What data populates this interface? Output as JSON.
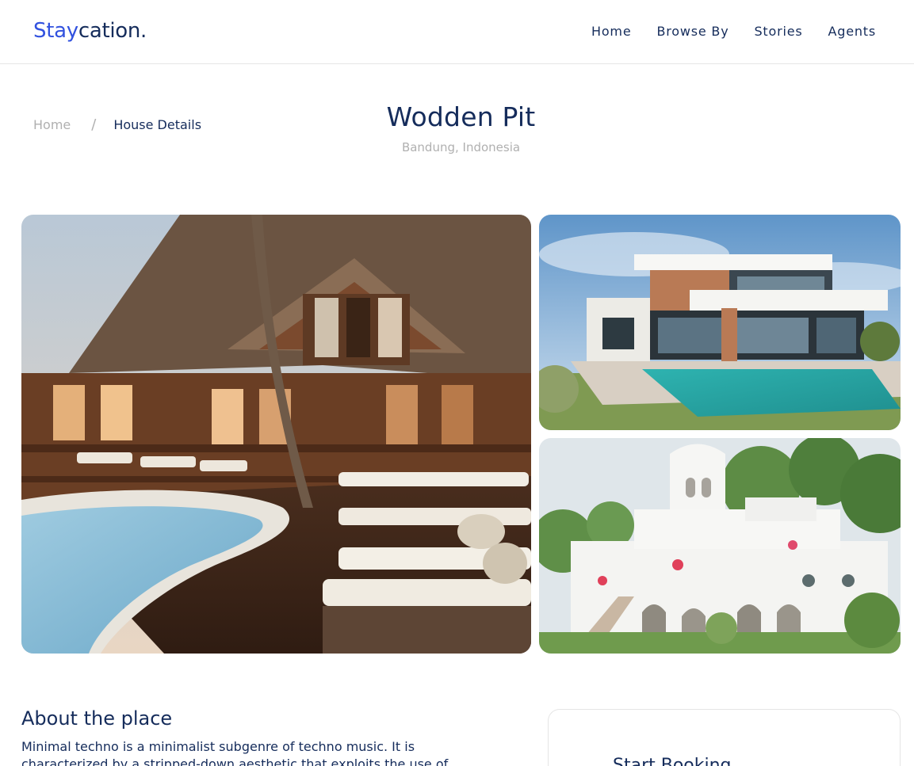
{
  "header": {
    "logo_accent": "Stay",
    "logo_rest": "cation.",
    "nav": [
      "Home",
      "Browse By",
      "Stories",
      "Agents"
    ]
  },
  "breadcrumb": {
    "home": "Home",
    "separator": "/",
    "current": "House Details"
  },
  "property": {
    "title": "Wodden Pit",
    "location": "Bandung, Indonesia"
  },
  "gallery": {
    "images": [
      "wooden-resort-pool-photo",
      "modern-villa-pool-photo",
      "white-mediterranean-house-photo"
    ]
  },
  "about": {
    "heading": "About the place",
    "text": "Minimal techno is a minimalist subgenre of techno music. It is characterized by a stripped-down aesthetic that exploits the use of"
  },
  "booking": {
    "title": "Start Booking"
  },
  "colors": {
    "primary": "#152c5b",
    "accent": "#3252df",
    "muted": "#b0b0b0"
  }
}
